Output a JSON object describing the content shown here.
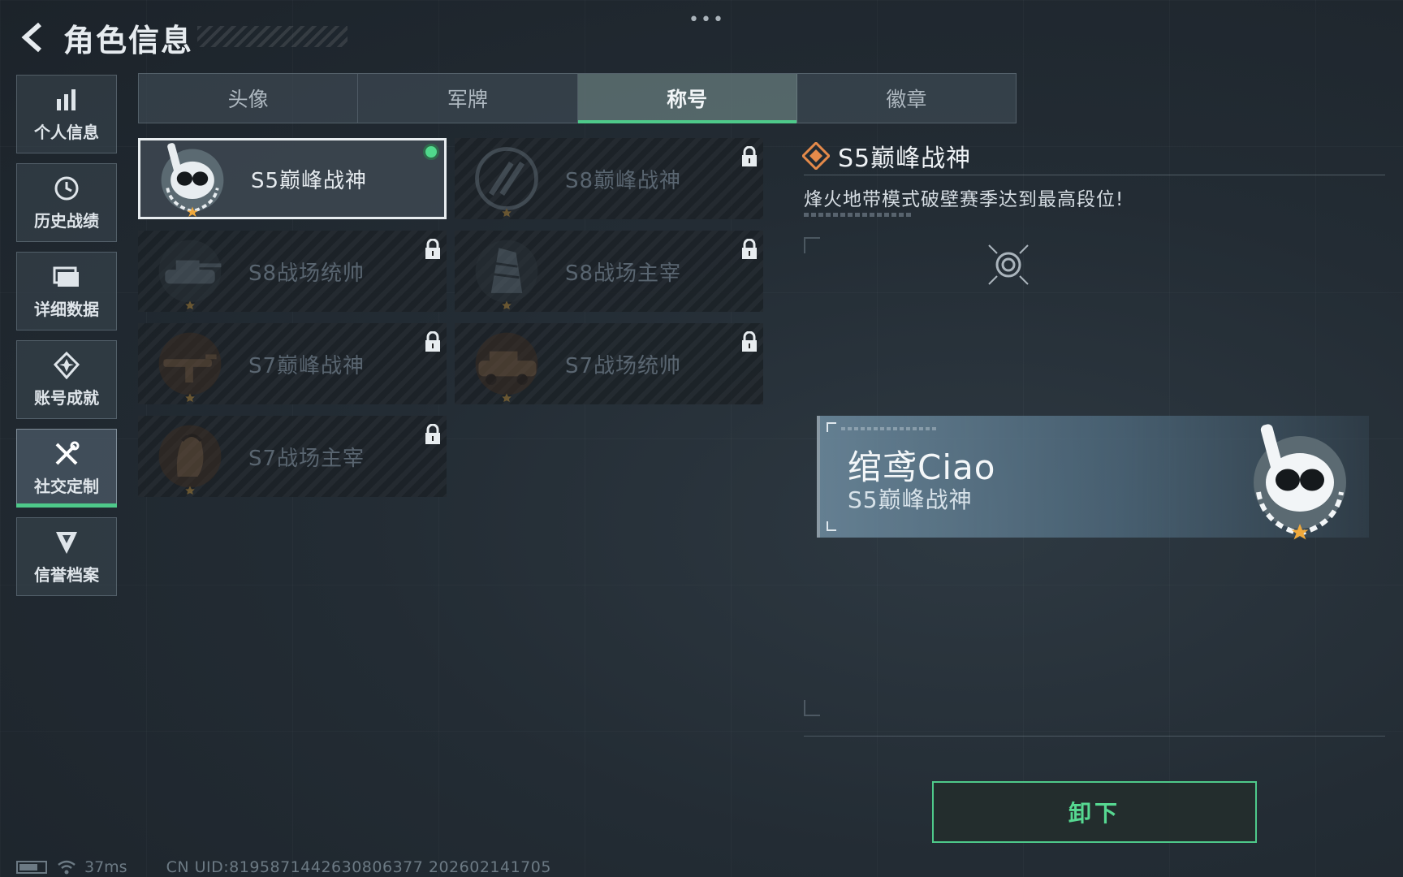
{
  "header": {
    "title": "角色信息",
    "back_icon": "back-arrow-icon",
    "more_icon": "more-dots-icon"
  },
  "sidebar": {
    "items": [
      {
        "label": "个人信息",
        "icon": "bar-chart-icon"
      },
      {
        "label": "历史战绩",
        "icon": "clock-icon"
      },
      {
        "label": "详细数据",
        "icon": "folder-icon"
      },
      {
        "label": "账号成就",
        "icon": "medal-icon"
      },
      {
        "label": "社交定制",
        "icon": "tools-icon",
        "active": true
      },
      {
        "label": "信誉档案",
        "icon": "shield-badge-icon"
      }
    ]
  },
  "tabs": [
    {
      "label": "头像"
    },
    {
      "label": "军牌"
    },
    {
      "label": "称号",
      "active": true
    },
    {
      "label": "徽章"
    }
  ],
  "titles": [
    {
      "label": "S5巅峰战神",
      "selected": true,
      "equipped": true,
      "locked": false
    },
    {
      "label": "S8巅峰战神",
      "locked": true
    },
    {
      "label": "S8战场统帅",
      "locked": true
    },
    {
      "label": "S8战场主宰",
      "locked": true
    },
    {
      "label": "S7巅峰战神",
      "locked": true
    },
    {
      "label": "S7战场统帅",
      "locked": true
    },
    {
      "label": "S7战场主宰",
      "locked": true
    }
  ],
  "detail": {
    "title": "S5巅峰战神",
    "description": "烽火地带模式破壁赛季达到最高段位!",
    "title_icon": "diamond-rank-icon",
    "view_icon": "target-view-icon"
  },
  "preview": {
    "player_name": "绾鸢Ciao",
    "title": "S5巅峰战神"
  },
  "unequip_label": "卸下",
  "status": {
    "ping": "37ms",
    "uid": "CN UID:8195871442630806377 202602141705"
  },
  "colors": {
    "accent_green": "#4ec98a",
    "title_icon_orange": "#e58a4a"
  }
}
